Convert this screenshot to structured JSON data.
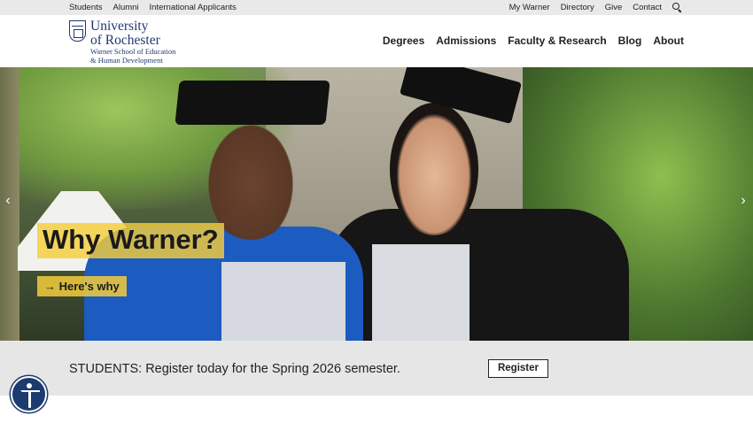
{
  "utility": {
    "left": [
      "Students",
      "Alumni",
      "International Applicants"
    ],
    "right": [
      "My Warner",
      "Directory",
      "Give",
      "Contact"
    ],
    "search_icon": "search-icon"
  },
  "logo": {
    "line1": "University",
    "line2": "of Rochester",
    "line3": "Warner School of Education",
    "line4": "& Human Development"
  },
  "nav": [
    "Degrees",
    "Admissions",
    "Faculty & Research",
    "Blog",
    "About"
  ],
  "hero": {
    "title": "Why Warner?",
    "cta": "→ Here's why"
  },
  "banner": {
    "message": "STUDENTS: Register today for the Spring 2026 semester.",
    "button": "Register"
  },
  "colors": {
    "brand": "#21396f",
    "accent": "#f5cd3c"
  }
}
